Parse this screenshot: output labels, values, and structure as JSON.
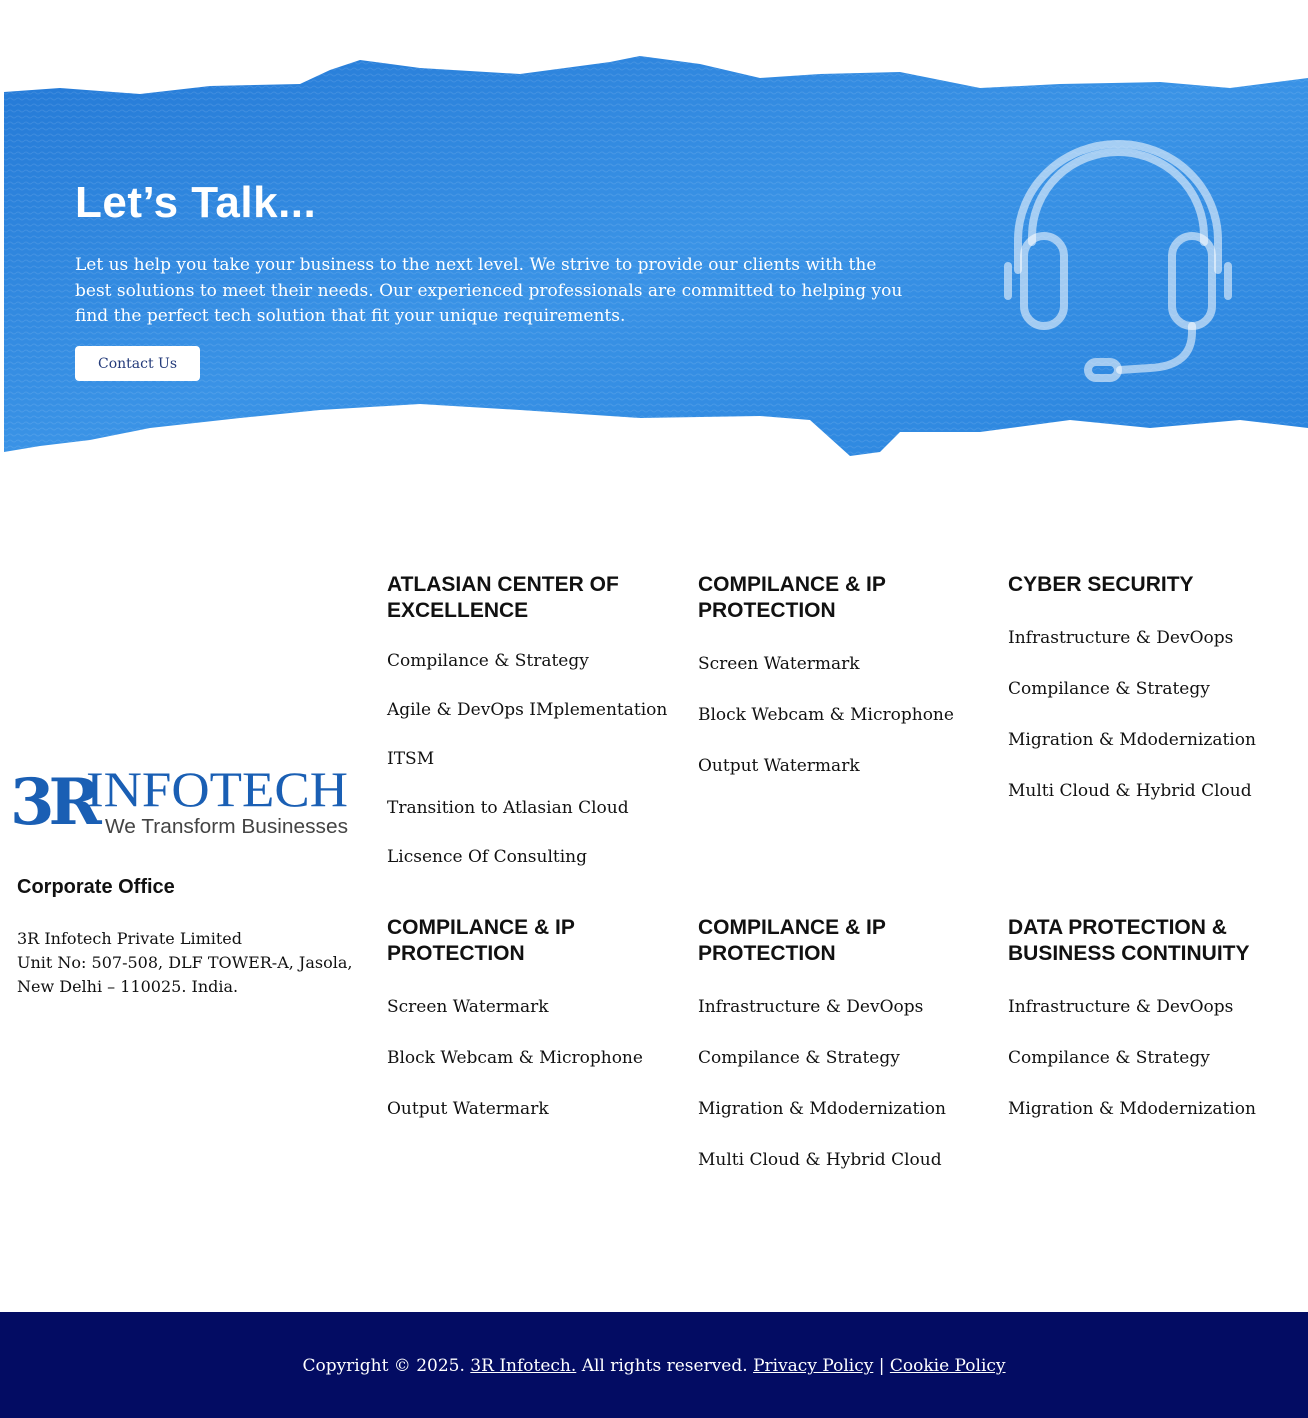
{
  "hero": {
    "title": "Let’s Talk...",
    "text": "Let us help you take your business to the next level. We strive to provide our clients with the best solutions to meet their needs. Our experienced professionals are committed to helping you find the perfect tech solution that fit your unique requirements.",
    "button_label": "Contact Us",
    "background_color": "#2b82de",
    "icon": "headset-icon"
  },
  "logo": {
    "mark": "3R",
    "name": "INFOTECH",
    "tagline": "We Transform Businesses",
    "color": "#1a5fb4"
  },
  "office": {
    "title": "Corporate Office",
    "lines": [
      "3R Infotech Private Limited",
      "Unit No: 507-508, DLF TOWER-A, Jasola,",
      "New Delhi – 110025. India."
    ]
  },
  "columns": [
    {
      "title": "ATLASIAN CENTER OF EXCELLENCE",
      "items": [
        "Compilance & Strategy",
        "Agile & DevOps IMplementation",
        "ITSM",
        "Transition to Atlasian Cloud",
        "Licsence Of Consulting"
      ]
    },
    {
      "title": "COMPILANCE & IP PROTECTION",
      "items": [
        "Screen Watermark",
        "Block Webcam & Microphone",
        "Output Watermark"
      ]
    },
    {
      "title": "CYBER SECURITY",
      "items": [
        "Infrastructure & DevOops",
        "Compilance & Strategy",
        "Migration & Mdodernization",
        "Multi Cloud & Hybrid Cloud"
      ]
    },
    {
      "title": "COMPILANCE & IP PROTECTION",
      "items": [
        "Screen Watermark",
        "Block Webcam & Microphone",
        "Output Watermark"
      ]
    },
    {
      "title": "COMPILANCE & IP PROTECTION",
      "items": [
        "Infrastructure & DevOops",
        "Compilance & Strategy",
        "Migration & Mdodernization",
        "Multi Cloud & Hybrid Cloud"
      ]
    },
    {
      "title": "DATA PROTECTION & BUSINESS CONTINUITY",
      "items": [
        "Infrastructure & DevOops",
        "Compilance & Strategy",
        "Migration & Mdodernization"
      ]
    }
  ],
  "footer": {
    "copyright_prefix": "Copyright © 2025.",
    "company_link": "3R Infotech.",
    "rights": "All rights reserved.",
    "privacy_link": "Privacy Policy",
    "separator": "|",
    "cookie_link": "Cookie Policy",
    "background_color": "#030c63"
  }
}
